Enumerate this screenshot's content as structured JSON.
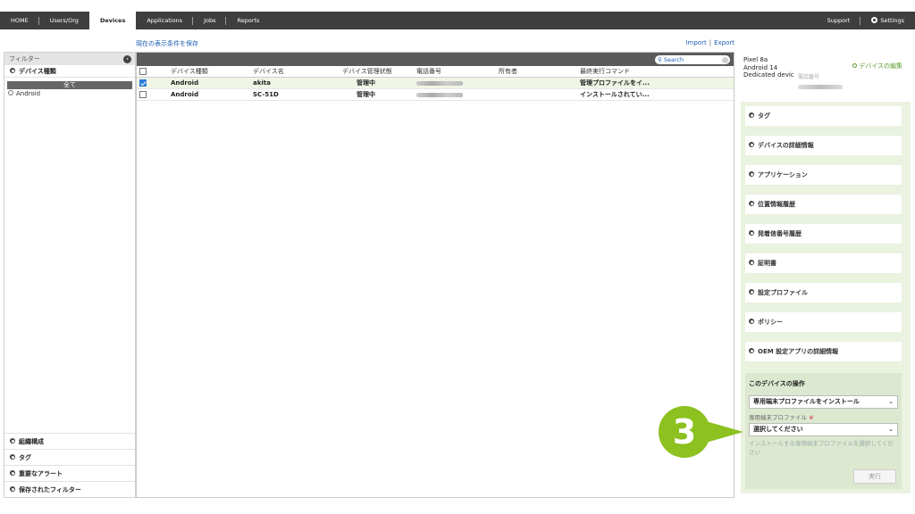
{
  "nav": {
    "items": [
      "HOME",
      "Users/Org",
      "Devices",
      "Applications",
      "Jobs",
      "Reports"
    ],
    "active": "Devices",
    "support": "Support",
    "settings": "Settings"
  },
  "toolbar": {
    "save_view": "現在の表示条件を保存",
    "import": "Import",
    "separator": "|",
    "export": "Export",
    "search_placeholder": "Search"
  },
  "sidebar": {
    "title": "フィルター",
    "device_type": "デバイス種類",
    "all": "全て",
    "android": "Android",
    "bottom_sections": [
      "組織構成",
      "タグ",
      "重要なアラート",
      "保存されたフィルター"
    ]
  },
  "table": {
    "headers": [
      "デバイス種類",
      "デバイス名",
      "デバイス管理状態",
      "電話番号",
      "所有者",
      "最終実行コマンド"
    ],
    "rows": [
      {
        "checked": true,
        "type": "Android",
        "name": "akita",
        "mgmt": "管理中",
        "owner": "",
        "cmd": "管理プロファイルをイ..."
      },
      {
        "checked": false,
        "type": "Android",
        "name": "SC-51D",
        "mgmt": "管理中",
        "owner": "",
        "cmd": "インストールされてい..."
      }
    ]
  },
  "detail": {
    "line1": "Pixel 8a",
    "line2": "Android 14",
    "line3": "Dedicated devic",
    "phone_label": "電話番号",
    "edit": "デバイスの編集",
    "sections": [
      "タグ",
      "デバイスの詳細情報",
      "アプリケーション",
      "位置情報履歴",
      "発着信番号履歴",
      "証明書",
      "設定プロファイル",
      "ポリシー",
      "OEM 設定アプリの詳細情報"
    ],
    "ops_title": "このデバイスの操作",
    "ops_action": "専用端末プロファイルをインストール",
    "profile_label": "専用端末プロファイル",
    "required_mark": "※",
    "profile_select": "選択してください",
    "hint": "インストールする専用端末プロファイルを選択してください",
    "run": "実行"
  },
  "step_badge": "3",
  "colors": {
    "accent": "#8cc11f",
    "nav_bg": "#3e3e3e",
    "link": "#1e5fb3"
  }
}
